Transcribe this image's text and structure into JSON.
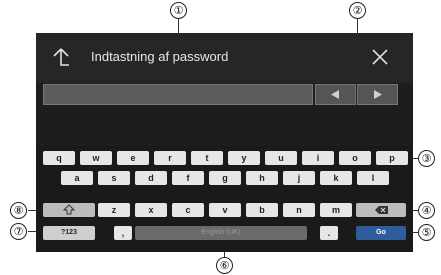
{
  "header": {
    "title": "Indtastning af password"
  },
  "keyboard": {
    "row1": [
      "q",
      "w",
      "e",
      "r",
      "t",
      "y",
      "u",
      "i",
      "o",
      "p"
    ],
    "row2": [
      "a",
      "s",
      "d",
      "f",
      "g",
      "h",
      "j",
      "k",
      "l"
    ],
    "row3": [
      "z",
      "x",
      "c",
      "v",
      "b",
      "n",
      "m"
    ],
    "symbols_label": "?123",
    "comma_label": ",",
    "space_label": "English (UK)",
    "period_label": ".",
    "go_label": "Go"
  },
  "callouts": [
    "①",
    "②",
    "③",
    "④",
    "⑤",
    "⑥",
    "⑦",
    "⑧"
  ],
  "icons": {
    "back": "back-arrow-icon",
    "close": "close-icon",
    "cursor_left": "triangle-left-icon",
    "cursor_right": "triangle-right-icon",
    "shift": "shift-icon",
    "backspace": "backspace-icon"
  }
}
